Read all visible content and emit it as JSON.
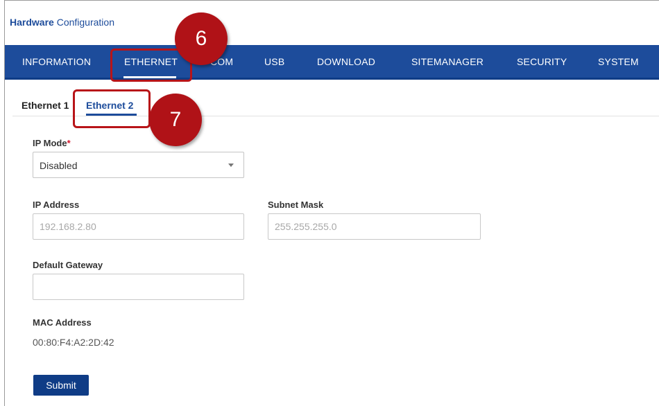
{
  "header": {
    "title_bold": "Hardware",
    "title_rest": " Configuration"
  },
  "nav": {
    "tabs": [
      {
        "label": "INFORMATION"
      },
      {
        "label": "ETHERNET"
      },
      {
        "label": "COM"
      },
      {
        "label": "USB"
      },
      {
        "label": "DOWNLOAD"
      },
      {
        "label": "SITEMANAGER"
      },
      {
        "label": "SECURITY"
      },
      {
        "label": "SYSTEM"
      }
    ],
    "active": "ETHERNET"
  },
  "subtabs": {
    "items": [
      {
        "label": "Ethernet 1"
      },
      {
        "label": "Ethernet 2"
      }
    ],
    "active": "Ethernet 2"
  },
  "form": {
    "ip_mode": {
      "label": "IP Mode",
      "required_mark": "*",
      "value": "Disabled"
    },
    "ip_address": {
      "label": "IP Address",
      "placeholder": "192.168.2.80"
    },
    "subnet_mask": {
      "label": "Subnet Mask",
      "placeholder": "255.255.255.0"
    },
    "default_gateway": {
      "label": "Default Gateway",
      "value": ""
    },
    "mac_address": {
      "label": "MAC Address",
      "value": "00:80:F4:A2:2D:42"
    },
    "submit_label": "Submit"
  },
  "callouts": {
    "step_6": "6",
    "step_7": "7"
  },
  "colors": {
    "brand_blue": "#1d4c9b",
    "callout_red": "#b01217",
    "required_red": "#d3162c"
  }
}
